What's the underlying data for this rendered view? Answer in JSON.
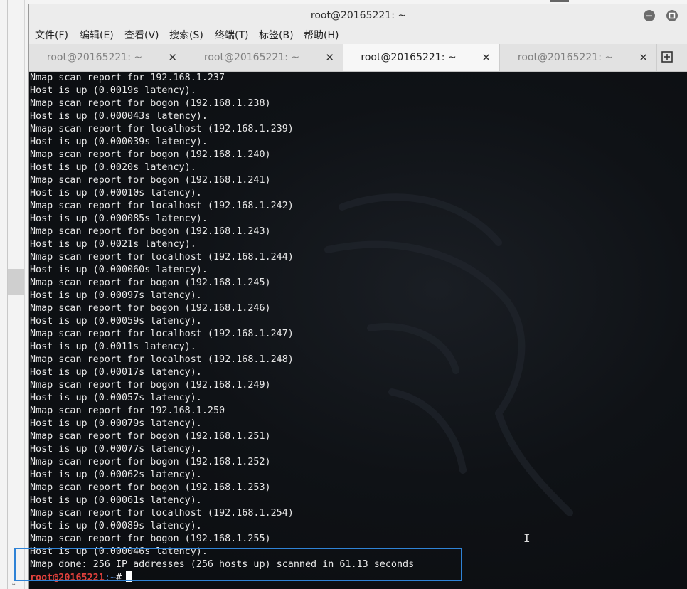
{
  "window": {
    "title": "root@20165221: ~",
    "minimize_icon": "minimize-icon",
    "maximize_icon": "maximize-icon"
  },
  "menu": {
    "items": [
      "文件(F)",
      "编辑(E)",
      "查看(V)",
      "搜索(S)",
      "终端(T)",
      "标签(B)",
      "帮助(H)"
    ]
  },
  "tabs": [
    {
      "label": "root@20165221: ~",
      "active": false
    },
    {
      "label": "root@20165221: ~",
      "active": false
    },
    {
      "label": "root@20165221: ~",
      "active": true
    },
    {
      "label": "root@20165221: ~",
      "active": false
    }
  ],
  "tab_close_glyph": "✕",
  "new_tab_icon": "new-tab-icon",
  "terminal": {
    "lines": [
      "Nmap scan report for 192.168.1.237",
      "Host is up (0.0019s latency).",
      "Nmap scan report for bogon (192.168.1.238)",
      "Host is up (0.000043s latency).",
      "Nmap scan report for localhost (192.168.1.239)",
      "Host is up (0.000039s latency).",
      "Nmap scan report for bogon (192.168.1.240)",
      "Host is up (0.0020s latency).",
      "Nmap scan report for bogon (192.168.1.241)",
      "Host is up (0.00010s latency).",
      "Nmap scan report for localhost (192.168.1.242)",
      "Host is up (0.000085s latency).",
      "Nmap scan report for bogon (192.168.1.243)",
      "Host is up (0.0021s latency).",
      "Nmap scan report for localhost (192.168.1.244)",
      "Host is up (0.000060s latency).",
      "Nmap scan report for bogon (192.168.1.245)",
      "Host is up (0.00097s latency).",
      "Nmap scan report for bogon (192.168.1.246)",
      "Host is up (0.00059s latency).",
      "Nmap scan report for localhost (192.168.1.247)",
      "Host is up (0.0011s latency).",
      "Nmap scan report for localhost (192.168.1.248)",
      "Host is up (0.00017s latency).",
      "Nmap scan report for bogon (192.168.1.249)",
      "Host is up (0.00057s latency).",
      "Nmap scan report for 192.168.1.250",
      "Host is up (0.00079s latency).",
      "Nmap scan report for bogon (192.168.1.251)",
      "Host is up (0.00077s latency).",
      "Nmap scan report for bogon (192.168.1.252)",
      "Host is up (0.00062s latency).",
      "Nmap scan report for bogon (192.168.1.253)",
      "Host is up (0.00061s latency).",
      "Nmap scan report for localhost (192.168.1.254)",
      "Host is up (0.00089s latency).",
      "Nmap scan report for bogon (192.168.1.255)",
      "Host is up (0.000046s latency).",
      "Nmap done: 256 IP addresses (256 hosts up) scanned in 61.13 seconds"
    ],
    "prompt": {
      "user_host": "root@20165221",
      "separator": ":~",
      "symbol": "#"
    }
  },
  "colors": {
    "prompt_user": "#e0403c",
    "prompt_path": "#5a8fd8",
    "highlight_box": "#2f83d6",
    "text": "#e9e9e9",
    "background": "#0d1014"
  }
}
